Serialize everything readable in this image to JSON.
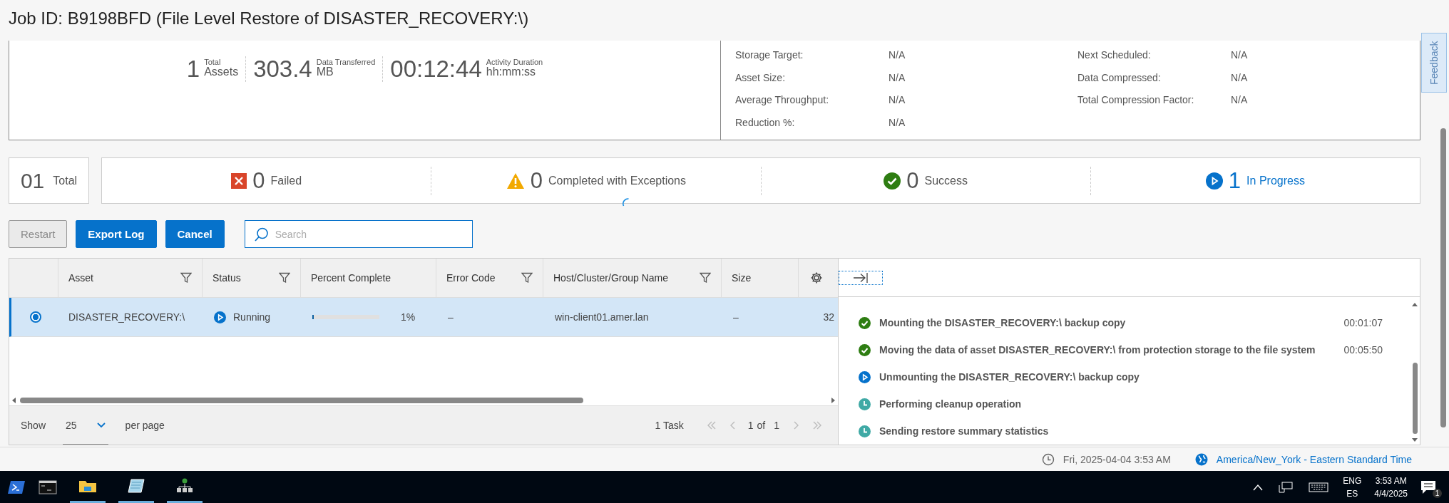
{
  "title": "Job ID: B9198BFD (File Level Restore of DISASTER_RECOVERY:\\)",
  "summary": {
    "metrics": [
      {
        "value": "1",
        "label_top": "Total",
        "label_bottom": "Assets"
      },
      {
        "value": "303.4",
        "label_top": "Data Transferred",
        "label_bottom": "MB"
      },
      {
        "value": "00:12:44",
        "label_top": "Activity Duration",
        "label_bottom": "hh:mm:ss"
      }
    ],
    "details_left": [
      {
        "label": "Storage Target:",
        "value": "N/A"
      },
      {
        "label": "Asset Size:",
        "value": "N/A"
      },
      {
        "label": "Average Throughput:",
        "value": "N/A"
      },
      {
        "label": "Reduction %:",
        "value": "N/A"
      }
    ],
    "details_right": [
      {
        "label": "Next Scheduled:",
        "value": "N/A"
      },
      {
        "label": "Data Compressed:",
        "value": "N/A"
      },
      {
        "label": "Total Compression Factor:",
        "value": "N/A"
      }
    ]
  },
  "feedback": "Feedback",
  "stats": {
    "total": {
      "value": "01",
      "label": "Total"
    },
    "items": [
      {
        "kind": "failed",
        "count": "0",
        "label": "Failed"
      },
      {
        "kind": "exceptions",
        "count": "0",
        "label": "Completed with Exceptions"
      },
      {
        "kind": "success",
        "count": "0",
        "label": "Success"
      },
      {
        "kind": "progress",
        "count": "1",
        "label": "In Progress"
      }
    ]
  },
  "buttons": [
    {
      "label": "Restart",
      "disabled": true
    },
    {
      "label": "Export Log",
      "disabled": false
    },
    {
      "label": "Cancel",
      "disabled": false
    }
  ],
  "search": {
    "placeholder": "Search"
  },
  "table": {
    "columns": [
      {
        "label": "Asset",
        "filter": true
      },
      {
        "label": "Status",
        "filter": true
      },
      {
        "label": "Percent Complete",
        "filter": false
      },
      {
        "label": "Error Code",
        "filter": true
      },
      {
        "label": "Host/Cluster/Group Name",
        "filter": true
      },
      {
        "label": "Size",
        "filter": false
      }
    ],
    "rows": [
      {
        "selected": true,
        "asset": "DISASTER_RECOVERY:\\",
        "status": {
          "kind": "running",
          "label": "Running"
        },
        "progress": {
          "level": 0.01,
          "reading": "1%"
        },
        "error_code": "–",
        "host": "win-client01.amer.lan",
        "size": "–",
        "column_7": "32"
      }
    ]
  },
  "pagination": {
    "show": "Show",
    "per_page": "25",
    "per_page_label": "per page",
    "count": "1 Task",
    "page": "1",
    "of": "of",
    "total_pages": "1"
  },
  "log": [
    {
      "kind": "done",
      "text": "Mounting the DISASTER_RECOVERY:\\ backup copy",
      "duration": "00:01:07"
    },
    {
      "kind": "done",
      "text": "Moving the data of asset DISASTER_RECOVERY:\\ from protection storage to the file system",
      "duration": "00:05:50"
    },
    {
      "kind": "running",
      "text": "Unmounting the DISASTER_RECOVERY:\\ backup copy"
    },
    {
      "kind": "pending",
      "text": "Performing cleanup operation"
    },
    {
      "kind": "pending",
      "text": "Sending restore summary statistics"
    }
  ],
  "status_bar": {
    "datetime": "Fri, 2025-04-04 3:53 AM",
    "timezone": "America/New_York - Eastern Standard Time"
  },
  "taskbar": {
    "language": "ENG",
    "layout": "ES",
    "time": "3:53 AM",
    "date": "4/4/2025",
    "notifications": "1"
  }
}
